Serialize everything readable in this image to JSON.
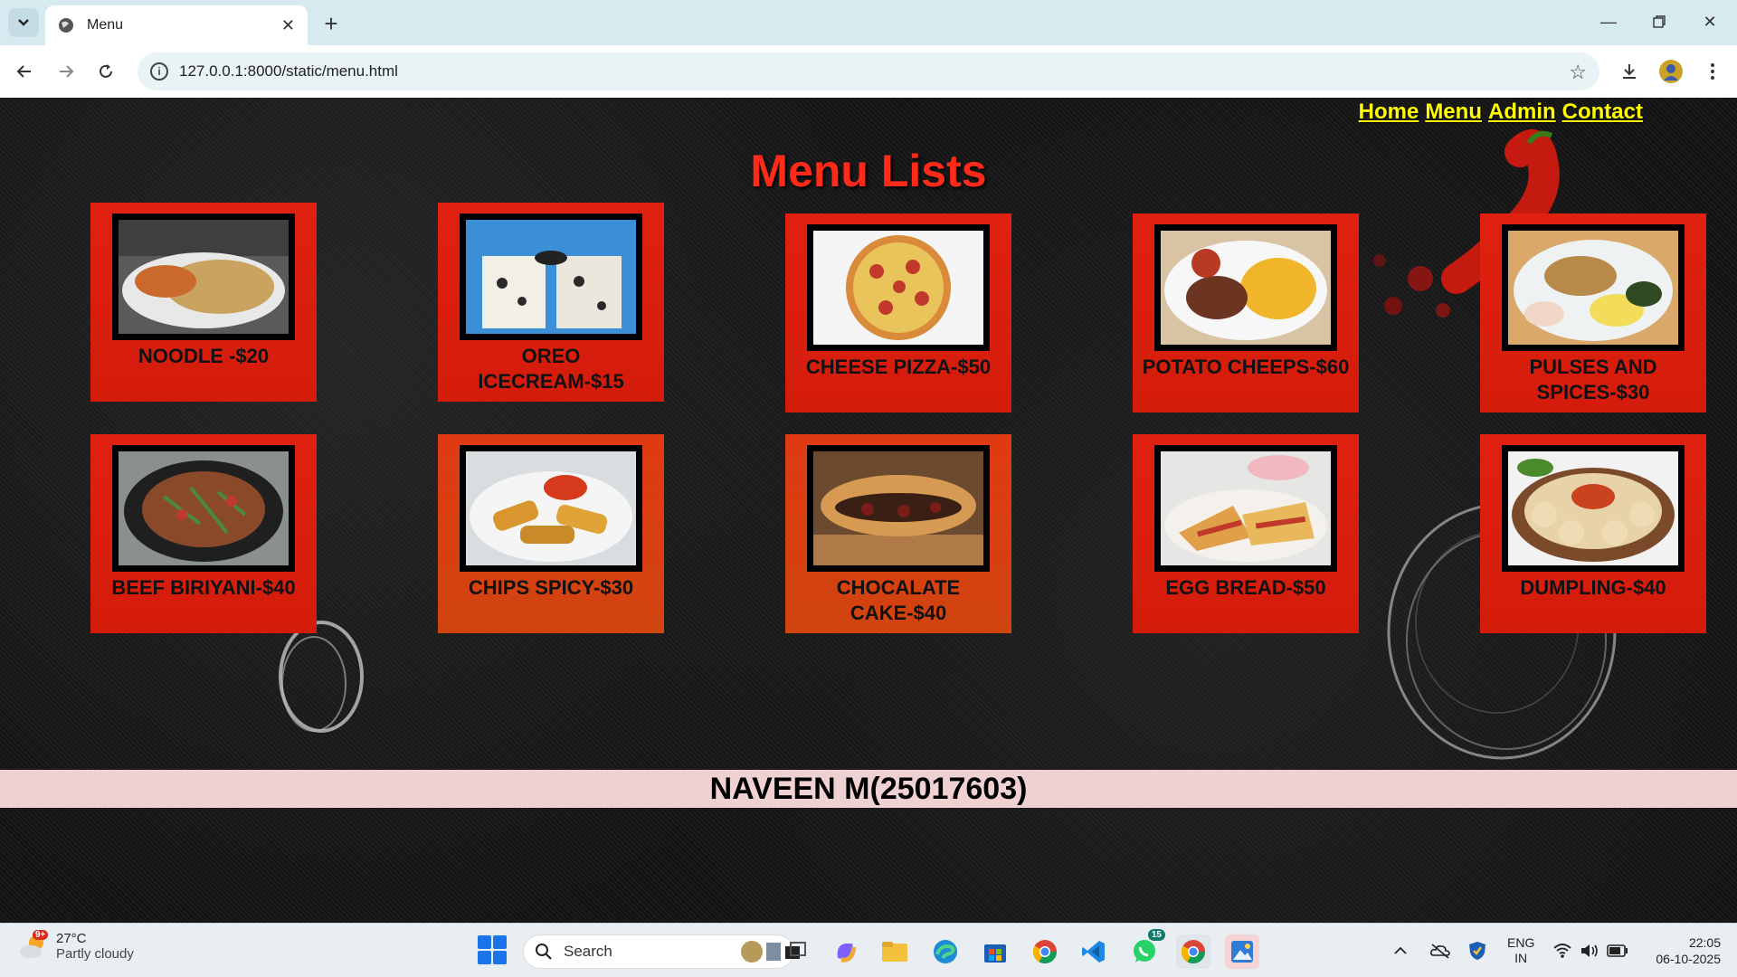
{
  "browser": {
    "tab_title": "Menu",
    "url": "127.0.0.1:8000/static/menu.html"
  },
  "nav": {
    "links": [
      "Home",
      "Menu",
      "Admin",
      "Contact"
    ],
    "link_color": "#ffff00"
  },
  "page": {
    "title": "Menu Lists",
    "title_color": "#ff2a1a",
    "footer": "NAVEEN M(25017603)",
    "footer_bg": "#f0d1d2",
    "card_color": "#e0210f"
  },
  "menu_items": [
    {
      "name": "NOODLE -$20"
    },
    {
      "name": "OREO ICECREAM-$15"
    },
    {
      "name": "CHEESE PIZZA-$50"
    },
    {
      "name": "POTATO CHEEPS-$60"
    },
    {
      "name": "PULSES AND SPICES-$30"
    },
    {
      "name": "BEEF BIRIYANI-$40"
    },
    {
      "name": "CHIPS SPICY-$30"
    },
    {
      "name": "CHOCALATE CAKE-$40"
    },
    {
      "name": "EGG BREAD-$50"
    },
    {
      "name": "DUMPLING-$40"
    }
  ],
  "taskbar": {
    "weather_temp": "27°C",
    "weather_cond": "Partly cloudy",
    "weather_badge": "9+",
    "search_placeholder": "Search",
    "whatsapp_badge": "15",
    "lang_top": "ENG",
    "lang_bottom": "IN",
    "time": "22:05",
    "date": "06-10-2025"
  }
}
